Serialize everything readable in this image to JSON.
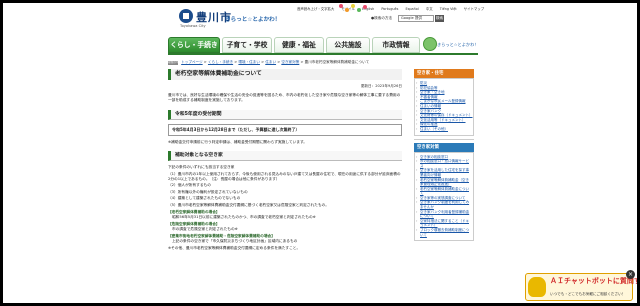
{
  "header": {
    "logo_text": "豊川市",
    "logo_sub": "Toyokawa City",
    "tagline": "きらっと☆とよかわ！",
    "util_links": [
      "音声読み上げ・文字拡大",
      "モバイル",
      "English",
      "Português",
      "Español",
      "中文",
      "Tiếng Việt",
      "サイトマップ"
    ],
    "text_size_label": "●検索の方法",
    "search_placeholder": "Google 提供",
    "search_button": "検索"
  },
  "nav": {
    "items": [
      {
        "label": "くらし・手続き",
        "active": true
      },
      {
        "label": "子育て・学校",
        "active": false
      },
      {
        "label": "健康・福祉",
        "active": false
      },
      {
        "label": "公共施設",
        "active": false
      },
      {
        "label": "市政情報",
        "active": false
      }
    ],
    "mascot_text": "きらっと☆とよかわ！"
  },
  "breadcrumb": {
    "icon_label": "現在のページ",
    "links": [
      "トップページ",
      "くらし・手続き",
      "環境・住まい",
      "住まい",
      "空き家対策"
    ],
    "current": "豊川市老朽空家等解体費補助金について"
  },
  "main": {
    "title": "老朽空家等解体費補助金について",
    "updated": "更新日：2023年9月26日",
    "intro": "豊川市では、良好な生活環境の確保や生活の安全の促進等を図るため、市内の老朽化した空き家や危険な空き家等の解体工事に要する費用の一部を助成する補助制度を実施しております。",
    "section1_title": "令和5年度の受付期間",
    "section1_box": "令和5年4月3日から12月28日まで（ただし、予算額に達し次第終了）",
    "section1_note": "※補助金交付申請前に行う判定申請は、補助金受付期間に関わらず実施しています。",
    "section2_title": "補助対象となる空き家",
    "section2_lead": "下記の条件のいずれにも該当する空き家",
    "conditions": [
      "（1）豊川市内の1年以上使用されておらず、今後も使用される見込みのない戸建て又は長屋の住宅で、現在の用途に供する部分が延床面積の2分の1以上であるもの。（注：長屋の場合は他に条件があります）",
      "（2）個人が所有するもの",
      "（3）所有権以外の権利が設定されていないもの",
      "（4）建築として建築されたものでないもの",
      "（5）豊川市老朽空家等解体費補助金交付要綱に基づく老朽空家又は危険空家と判定されたもの。"
    ],
    "judgement": [
      {
        "head": "【老朽空家解体費補助の場合】",
        "body": "昭和56年5月31日以前に建築されたものかつ、市の調査で老朽空家と判定されたもの※"
      },
      {
        "head": "【危険空家解体費補助の場合】",
        "body": "市の調査で危険空家と判定されたもの※"
      },
      {
        "head": "【密集市街地老朽空家解体費補助・危険空家解体費補助の場合】",
        "body": "上記の条件の空き家で「市久保防災まちづくり地区計画」区域内にあるもの"
      }
    ],
    "footnote": "※その他、豊川市老朽空家等解体費補助金交付要綱に定める条件を満たすこと。"
  },
  "sidebar": {
    "section1_title": "空き家・住宅",
    "colors": {
      "section1": "#e07a1c",
      "section2": "#2a7ab8"
    },
    "section1_items": [
      "防災",
      "防犯協会等",
      "空き家・空き地",
      "不審者情報",
      "こまかな市民メール登録情報",
      "住まいの情報",
      "空き家バンク",
      "文化財等の保存（ドキュメント）",
      "文化活用等（ドキュメント）",
      "緑化の推進",
      "住まい（その他）"
    ],
    "section2_title": "空き家対策",
    "section2_items": [
      "空き家の相談窓口",
      "市の相談窓口・窓口情報サービス",
      "空き家を活用した住宅を探す事業者向け情報",
      "老朽空家等解体費補助金（空き家管理適正化推進）",
      "老朽空家等解体費補助金について",
      "空き家等の実態調査について",
      "空き家バンク制度を利用してみませんか",
      "空き家バンク利用者登録補助金について",
      "空家特措法に関すること（ドキュメント）",
      "ブロック塀撤去費補助制度について"
    ]
  },
  "chatbot": {
    "title": "ＡＩチャットボットに質問するだリン☆",
    "subtitle": "いつでも・どこでもお気軽にご相談ください！",
    "close": "×"
  }
}
